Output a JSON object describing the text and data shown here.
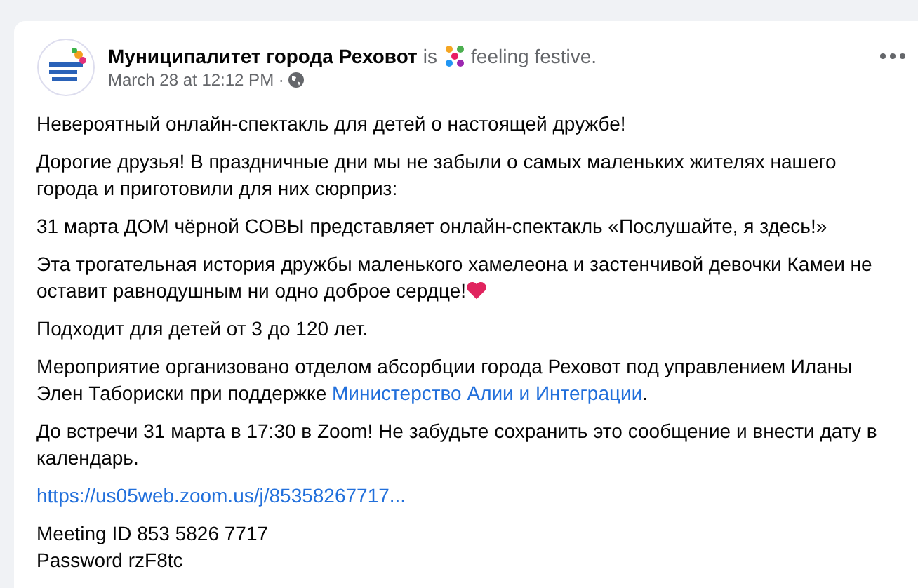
{
  "post": {
    "author": "Муниципалитет города Реховот",
    "activity": [
      {
        "kind": "text",
        "text": "is"
      },
      {
        "kind": "festive"
      },
      {
        "kind": "text",
        "text": "feeling festive."
      }
    ],
    "time": "March 28 at 12:12 PM ·",
    "paragraphs": [
      [
        {
          "kind": "text",
          "text": "Невероятный онлайн-спектакль для детей о настоящей дружбе!"
        }
      ],
      [
        {
          "kind": "text",
          "text": "Дорогие друзья! В праздничные дни мы не забыли о самых маленьких жителях нашего города и приготовили для них сюрприз:"
        }
      ],
      [
        {
          "kind": "text",
          "text": "31 марта ДОМ чёрной СОВЫ представляет онлайн-спектакль «Послушайте, я здесь!»"
        }
      ],
      [
        {
          "kind": "text",
          "text": "Эта трогательная история дружбы маленького хамелеона и застенчивой девочки Камеи не оставит равнодушным ни одно доброе сердце!"
        },
        {
          "kind": "heart"
        }
      ],
      [
        {
          "kind": "text",
          "text": "Подходит для детей от 3 до 120 лет."
        }
      ],
      [
        {
          "kind": "text",
          "text": "Мероприятие организовано отделом абсорбции города Реховот под управлением Иланы Элен Табориски при поддержке "
        },
        {
          "kind": "link",
          "text": "Министерство Алии и Интеграции"
        },
        {
          "kind": "text",
          "text": "."
        }
      ],
      [
        {
          "kind": "text",
          "text": "До встречи 31 марта в 17:30 в Zoom! Не забудьте сохранить это сообщение и внести дату в календарь."
        }
      ],
      [
        {
          "kind": "link",
          "text": "https://us05web.zoom.us/j/85358267717..."
        }
      ]
    ],
    "details": [
      "Meeting ID 853 5826 7717",
      "Password rzF8tc"
    ]
  }
}
